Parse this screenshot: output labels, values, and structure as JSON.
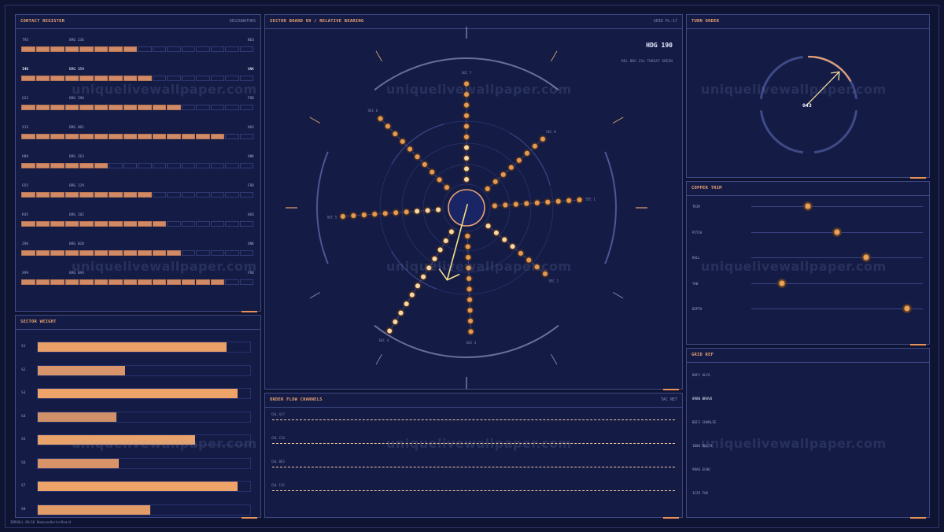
{
  "colors": {
    "bg": "#0f1433",
    "panel": "#141c46",
    "border": "#3f4a86",
    "accent": "#e8925a",
    "bar": "#d08a66",
    "node": "#e39a55",
    "arrow": "#f4e08a"
  },
  "contact_register": {
    "title": "CONTACT REGISTER",
    "subtitle": "DESIGNATORS",
    "rows": [
      {
        "id": "T95",
        "brg": "BRG 236",
        "status": "NEU",
        "filled": 8,
        "highlight": false
      },
      {
        "id": "I45",
        "brg": "BRG 359",
        "status": "UNK",
        "filled": 9,
        "highlight": true
      },
      {
        "id": "G22",
        "brg": "BRG 296",
        "status": "FRD",
        "filled": 11,
        "highlight": false
      },
      {
        "id": "X13",
        "brg": "BRG 061",
        "status": "HOS",
        "filled": 14,
        "highlight": false
      },
      {
        "id": "H89",
        "brg": "BRG 263",
        "status": "UNK",
        "filled": 6,
        "highlight": false
      },
      {
        "id": "G55",
        "brg": "BRG 129",
        "status": "FRD",
        "filled": 9,
        "highlight": false
      },
      {
        "id": "R45",
        "brg": "BRG 282",
        "status": "HOS",
        "filled": 10,
        "highlight": false
      },
      {
        "id": "Z96",
        "brg": "BRG 020",
        "status": "UNK",
        "filled": 11,
        "highlight": false
      },
      {
        "id": "X99",
        "brg": "BRG 094",
        "status": "FRD",
        "filled": 14,
        "highlight": false
      }
    ]
  },
  "sector_weight": {
    "title": "SECTOR WEIGHT",
    "bars": [
      {
        "label": "S1",
        "value": 0.89,
        "color": "#e8a068"
      },
      {
        "label": "S2",
        "value": 0.41,
        "color": "#d8946a"
      },
      {
        "label": "S3",
        "value": 0.94,
        "color": "#eea468"
      },
      {
        "label": "S4",
        "value": 0.37,
        "color": "#d0916a"
      },
      {
        "label": "S5",
        "value": 0.74,
        "color": "#e9a26a"
      },
      {
        "label": "S6",
        "value": 0.38,
        "color": "#d89468"
      },
      {
        "label": "S7",
        "value": 0.94,
        "color": "#eea468"
      },
      {
        "label": "S8",
        "value": 0.53,
        "color": "#e29c68"
      }
    ]
  },
  "sector_board": {
    "title": "SECTOR BOARD 09 / RELATIVE BEARING",
    "subtitle": "GRID PL-17",
    "heading": "HDG 190",
    "info": "REL BRG 23o  THREAT GREEN",
    "spokes": [
      {
        "label": "SEC 7",
        "angle_deg": 0,
        "count": 10,
        "lit": [
          0,
          1,
          2,
          3
        ]
      },
      {
        "label": "SEC 0",
        "angle_deg": 48,
        "count": 8,
        "lit": []
      },
      {
        "label": "SEC 1",
        "angle_deg": 86,
        "count": 9,
        "lit": []
      },
      {
        "label": "SEC 2",
        "angle_deg": 130,
        "count": 8,
        "lit": [
          0,
          1,
          2,
          3
        ]
      },
      {
        "label": "SEC 3",
        "angle_deg": 178,
        "count": 10,
        "lit": []
      },
      {
        "label": "SEC 4",
        "angle_deg": 212,
        "count": 12,
        "lit": [
          0,
          1,
          2,
          3,
          4,
          5,
          6,
          7,
          8,
          9,
          10,
          11
        ]
      },
      {
        "label": "SEC 5",
        "angle_deg": 266,
        "count": 10,
        "lit": [
          0,
          1,
          2
        ]
      },
      {
        "label": "SEC 6",
        "angle_deg": 316,
        "count": 10,
        "lit": []
      }
    ],
    "pointer_deg": 195
  },
  "order_flow": {
    "title": "ORDER FLOW CHANNELS",
    "subtitle": "TAC NET",
    "channels": [
      "CHL A17",
      "CHL C34",
      "CHL B63",
      "CHL F42"
    ]
  },
  "turn_order": {
    "title": "TURN ORDER",
    "value": "043",
    "bearing_deg": 43
  },
  "copper_trim": {
    "title": "COPPER TRIM",
    "sliders": [
      {
        "label": "TRIM",
        "value": 0.33
      },
      {
        "label": "PITCH",
        "value": 0.5
      },
      {
        "label": "ROLL",
        "value": 0.67
      },
      {
        "label": "YAW",
        "value": 0.18
      },
      {
        "label": "DEPTH",
        "value": 0.91
      }
    ]
  },
  "grid_ref": {
    "title": "GRID REF",
    "items": [
      {
        "label": "8AFC ALFA",
        "bright": false
      },
      {
        "label": "8980 BRAVO",
        "bright": true
      },
      {
        "label": "BEF2 CHARLIE",
        "bright": false
      },
      {
        "label": "1B08 DELTA",
        "bright": false
      },
      {
        "label": "99A6 ECHO",
        "bright": false
      },
      {
        "label": "1C25 FOX",
        "bright": false
      }
    ]
  },
  "footer": "INDVOLL 09/18 RemaxnoHarterBoard",
  "watermark": "uniquelivewallpaper.com"
}
